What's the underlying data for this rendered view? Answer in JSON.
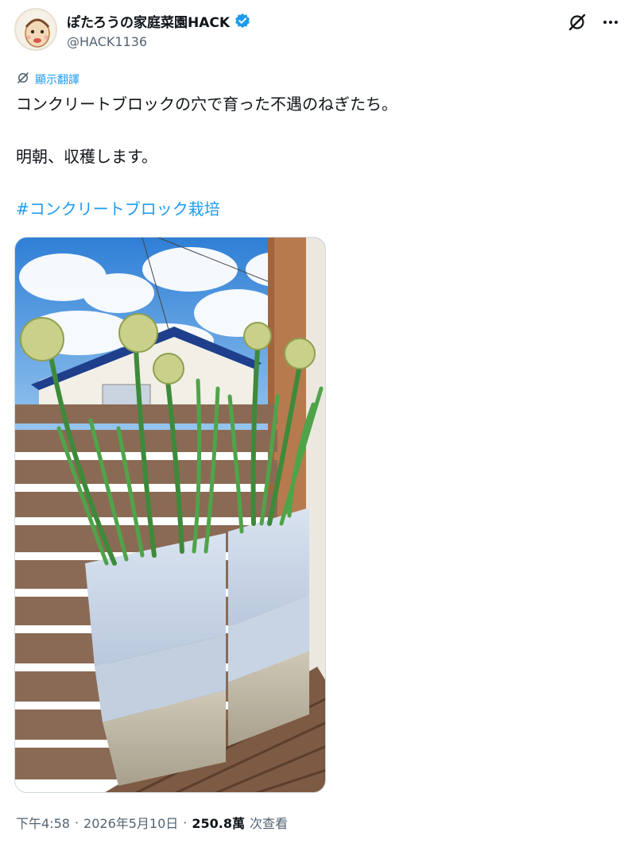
{
  "author": {
    "display_name": "ぽたろうの家庭菜園HACK",
    "handle": "@HACK1136",
    "verified": true
  },
  "actions": {
    "grok_icon": "grok-icon",
    "more_icon": "more-icon"
  },
  "translate": {
    "label": "顯示翻譯"
  },
  "tweet": {
    "line1": "コンクリートブロックの穴で育った不遇のねぎたち。",
    "line2": "明朝、収穫します。",
    "hashtag": "#コンクリートブロック栽培"
  },
  "meta": {
    "time": "下午4:58",
    "sep1": "·",
    "date": "2026年5月10日",
    "sep2": "·",
    "views": "250.8萬",
    "views_label": "次查看"
  },
  "colors": {
    "link": "#1d9bf0",
    "text": "#0f1419",
    "secondary": "#536471"
  }
}
